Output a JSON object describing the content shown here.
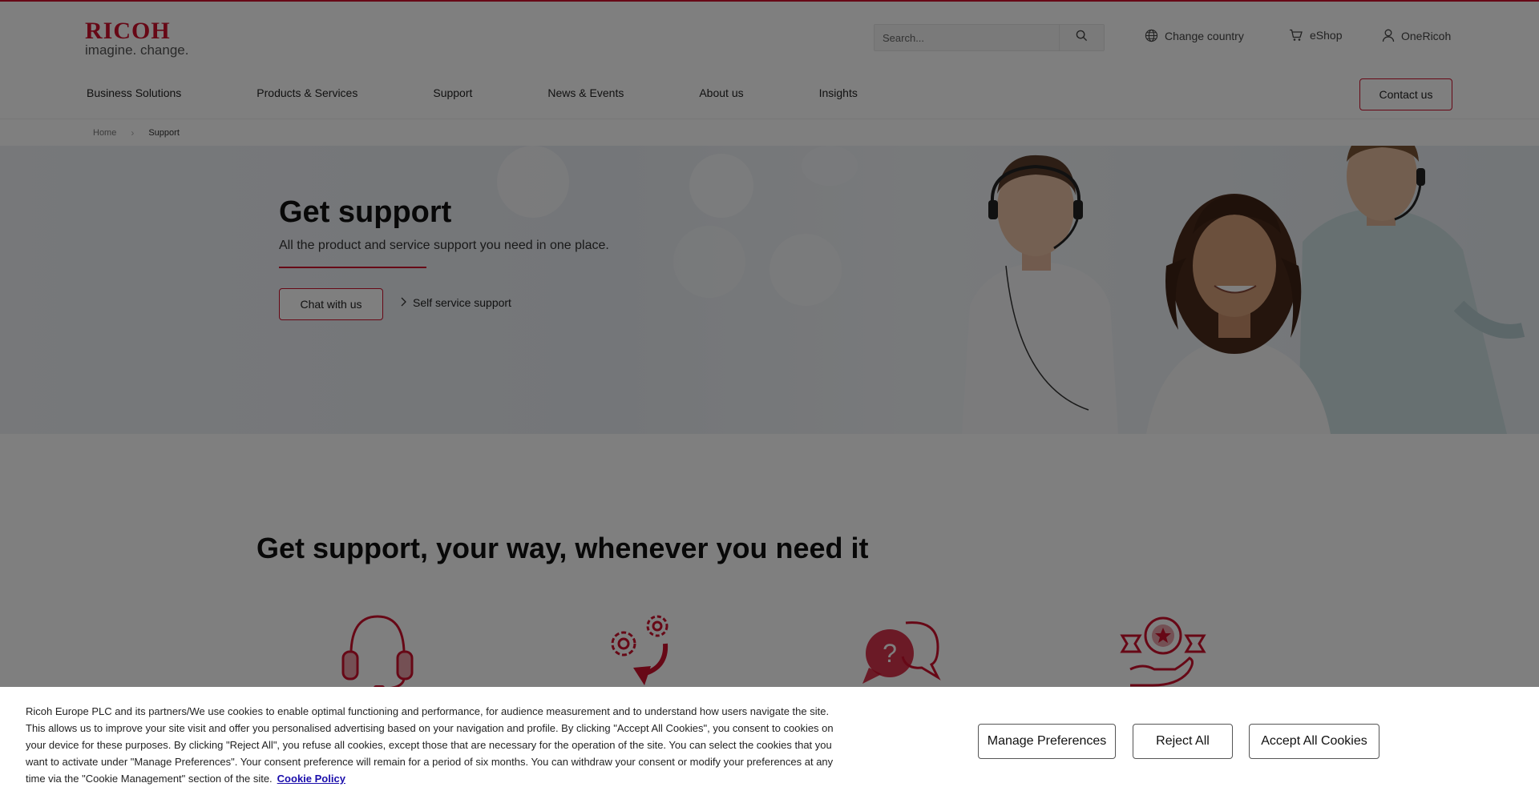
{
  "brand": {
    "name": "RICOH",
    "tagline": "imagine. change.",
    "accent": "#cf102d"
  },
  "header": {
    "search_placeholder": "Search...",
    "change_country": "Change country",
    "eshop": "eShop",
    "onericoh": "OneRicoh",
    "contact_us": "Contact us"
  },
  "nav": {
    "items": [
      {
        "label": "Business Solutions"
      },
      {
        "label": "Products & Services"
      },
      {
        "label": "Support"
      },
      {
        "label": "News & Events"
      },
      {
        "label": "About us"
      },
      {
        "label": "Insights"
      }
    ]
  },
  "breadcrumb": {
    "home": "Home",
    "current": "Support"
  },
  "hero": {
    "title": "Get support",
    "subtitle": "All the product and service support you need in one place.",
    "chat_button": "Chat with us",
    "self_service": "Self service support"
  },
  "section": {
    "title": "Get support, your way, whenever you need it",
    "icons": [
      "headset-icon",
      "gears-icon",
      "question-chat-icon",
      "award-hand-icon"
    ]
  },
  "cookie": {
    "text": "Ricoh Europe PLC and its partners/We use cookies to enable optimal functioning and performance, for audience measurement and to understand how users navigate the site. This allows us to improve your site visit and offer you personalised advertising based on your navigation and profile. By clicking \"Accept All Cookies\", you consent to cookies on your device for these purposes. By clicking \"Reject All\", you refuse all cookies, except those that are necessary for the operation of the site. You can select the cookies that you want to activate under \"Manage Preferences\". Your consent preference will remain for a period of six months. You can withdraw your consent or modify your preferences at any time via the \"Cookie Management\" section of the site.",
    "policy_link": "Cookie Policy",
    "manage": "Manage Preferences",
    "reject": "Reject All",
    "accept": "Accept All Cookies"
  }
}
